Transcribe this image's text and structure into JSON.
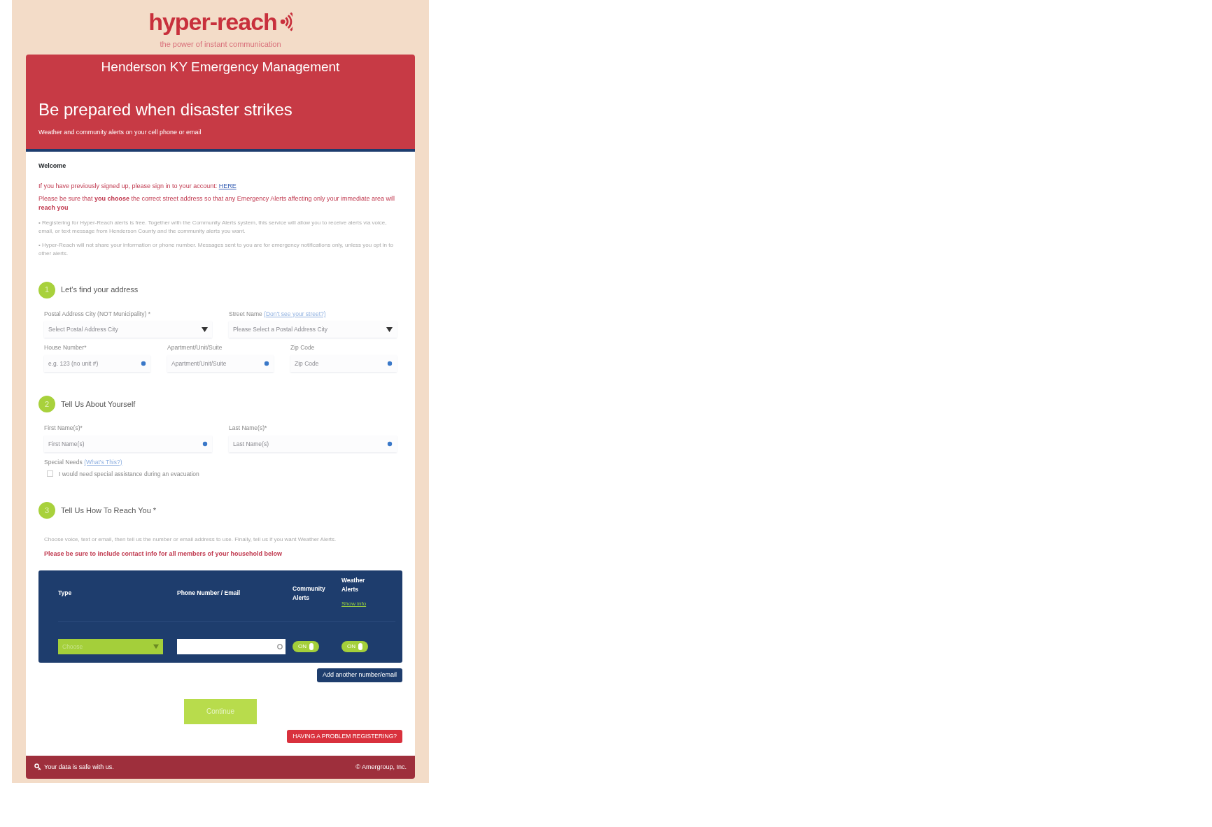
{
  "logo": {
    "wordmark": "hyper-reach",
    "tagline": "the power of instant communication"
  },
  "header": {
    "agency": "Henderson KY Emergency Management",
    "headline": "Be prepared when disaster strikes",
    "subline": "Weather and community alerts on your cell phone or email"
  },
  "welcome": {
    "title": "Welcome",
    "signin_text": "If you have previously signed up, please sign in to your account:",
    "signin_link": "HERE",
    "address_note": "Please be sure that **you choose** the correct street address so that any Emergency Alerts affecting only your immediate area will **reach you**",
    "bullets": [
      "• Registering for Hyper-Reach alerts is free. Together with the Community Alerts system, this service will allow you to receive alerts via voice, email, or text message from Henderson County and the community alerts you want.",
      "• Hyper-Reach will not share your information or phone number. Messages sent to you are for emergency notifications only, unless you opt in to other alerts."
    ]
  },
  "steps": [
    {
      "number": "1",
      "title": "Let's find your address",
      "lines": [
        {
          "fields": [
            {
              "label": "Postal Address City (NOT Municipality) *",
              "kind": "select",
              "placeholder": "Select Postal Address City"
            },
            {
              "label": "Street Name",
              "link": "(Don't see your street?)",
              "kind": "select",
              "placeholder": "Please Select a Postal Address City"
            }
          ]
        },
        {
          "fields": [
            {
              "label": "House Number*",
              "kind": "input",
              "placeholder": "e.g. 123 (no unit #)"
            },
            {
              "label": "Apartment/Unit/Suite",
              "kind": "input",
              "placeholder": "Apartment/Unit/Suite"
            },
            {
              "label": "Zip Code",
              "kind": "input",
              "placeholder": "Zip Code"
            }
          ]
        }
      ]
    },
    {
      "number": "2",
      "title": "Tell Us About Yourself",
      "lines": [
        {
          "fields": [
            {
              "label": "First Name(s)*",
              "kind": "input",
              "placeholder": "First Name(s)"
            },
            {
              "label": "Last Name(s)*",
              "kind": "input",
              "placeholder": "Last Name(s)"
            }
          ]
        }
      ],
      "special_needs": {
        "label": "Special Needs",
        "link": "(What's This?)",
        "checkbox_label": "I would need special assistance during an evacuation",
        "checked": false
      }
    },
    {
      "number": "3",
      "title": "Tell Us How To Reach You *",
      "intro": "Choose voice, text or email, then tell us the number or email address to use. Finally, tell us if you want Weather Alerts.",
      "warning": "Please be sure to include contact info for all members of your household below"
    }
  ],
  "contacts": {
    "columns": [
      "Type",
      "Phone Number / Email",
      "Community Alerts",
      "Weather Alerts"
    ],
    "weather_link": "Show info",
    "rows": [
      {
        "type": "Choose",
        "community": {
          "label": "ON",
          "on": true
        },
        "weather": {
          "label": "ON",
          "on": true
        }
      }
    ],
    "add_button": "Add another number/email"
  },
  "continue_button": "Continue",
  "problem_button": "HAVING A PROBLEM REGISTERING?",
  "footer": {
    "safe_text": "Your data is safe with us.",
    "copyright": "© Amergroup, Inc."
  }
}
